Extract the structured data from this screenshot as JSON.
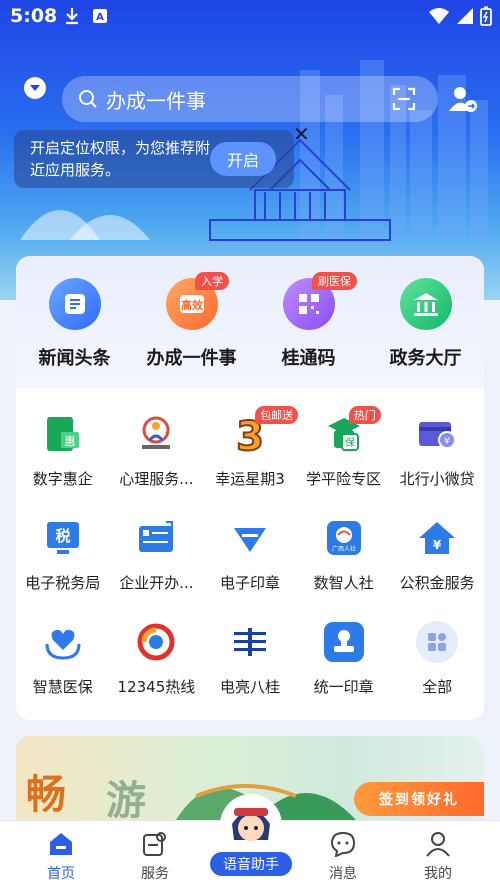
{
  "status_bar": {
    "time": "5:08"
  },
  "search": {
    "text": "办成一件事"
  },
  "location_prompt": {
    "message": "开启定位权限，为您推荐附近应用服务。",
    "button": "开启",
    "close": "✕"
  },
  "featured": [
    {
      "label": "新闻头条",
      "icon": "news-icon",
      "badge": ""
    },
    {
      "label": "办成一件事",
      "icon": "one-thing-icon",
      "badge": "入学"
    },
    {
      "label": "桂通码",
      "icon": "qr-code-icon",
      "badge": "刷医保"
    },
    {
      "label": "政务大厅",
      "icon": "government-hall-icon",
      "badge": ""
    }
  ],
  "grid": [
    {
      "label": "数字惠企",
      "icon": "digital-enterprise-icon",
      "badge": ""
    },
    {
      "label": "心理服务...",
      "icon": "psychology-service-icon",
      "badge": ""
    },
    {
      "label": "幸运星期3",
      "icon": "lucky-wednesday-icon",
      "badge": "包邮送"
    },
    {
      "label": "学平险专区",
      "icon": "student-insurance-icon",
      "badge": "热门"
    },
    {
      "label": "北行小微贷",
      "icon": "micro-loan-icon",
      "badge": ""
    },
    {
      "label": "电子税务局",
      "icon": "e-tax-icon",
      "badge": ""
    },
    {
      "label": "企业开办...",
      "icon": "business-setup-icon",
      "badge": ""
    },
    {
      "label": "电子印章",
      "icon": "e-seal-icon",
      "badge": ""
    },
    {
      "label": "数智人社",
      "icon": "social-security-icon",
      "badge": ""
    },
    {
      "label": "公积金服务",
      "icon": "housing-fund-icon",
      "badge": ""
    },
    {
      "label": "智慧医保",
      "icon": "medical-insurance-icon",
      "badge": ""
    },
    {
      "label": "12345热线",
      "icon": "hotline-icon",
      "badge": ""
    },
    {
      "label": "电亮八桂",
      "icon": "power-bagui-icon",
      "badge": ""
    },
    {
      "label": "统一印章",
      "icon": "unified-seal-icon",
      "badge": ""
    },
    {
      "label": "全部",
      "icon": "all-apps-icon",
      "badge": ""
    }
  ],
  "promo": {
    "cta": "签到领好礼"
  },
  "tabs": [
    {
      "label": "首页",
      "icon": "home-icon",
      "active": true
    },
    {
      "label": "服务",
      "icon": "service-icon",
      "active": false
    },
    {
      "label": "语音助手",
      "icon": "voice-assistant-icon",
      "active": false
    },
    {
      "label": "消息",
      "icon": "message-icon",
      "active": false
    },
    {
      "label": "我的",
      "icon": "profile-icon",
      "active": false
    }
  ],
  "colors": {
    "primary": "#2c5fe6",
    "badge": "#f0524a",
    "hero_top": "#1f45e6"
  }
}
